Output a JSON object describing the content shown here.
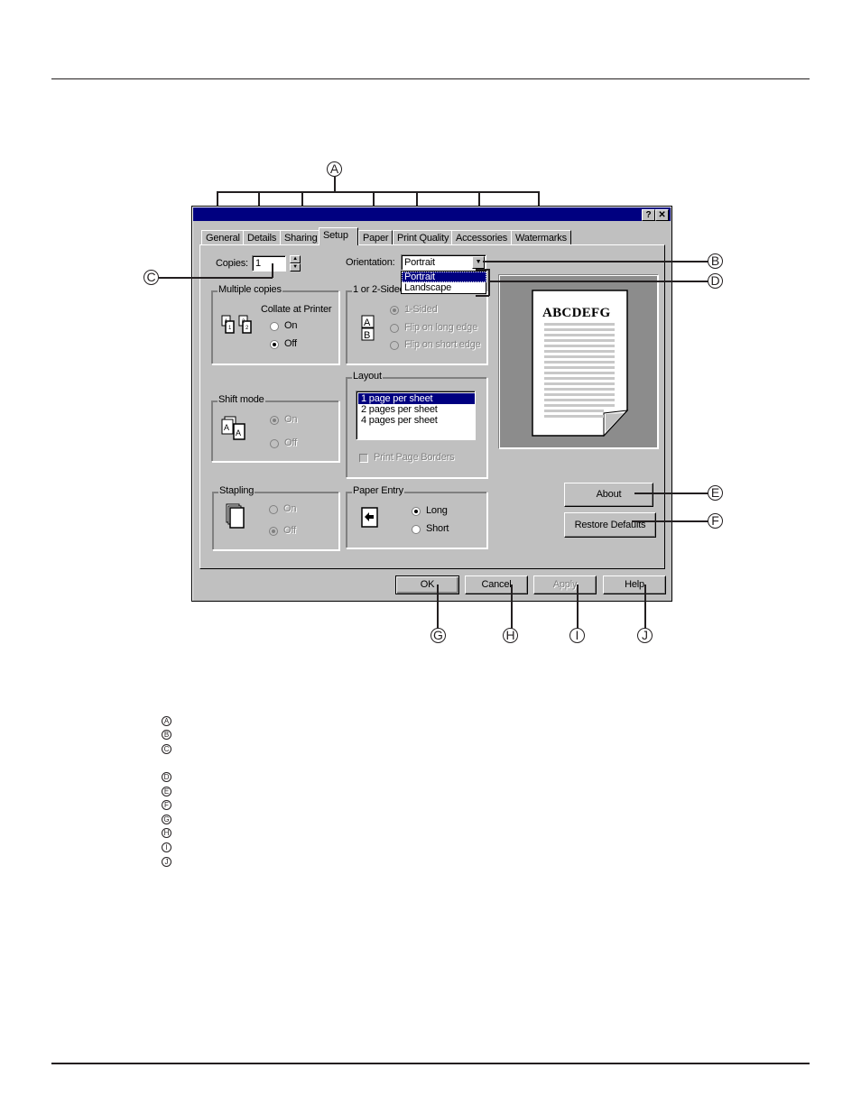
{
  "dialog": {
    "title_buttons": {
      "help": "?",
      "close": "✕"
    },
    "tabs": [
      {
        "label": "General",
        "active": false
      },
      {
        "label": "Details",
        "active": false
      },
      {
        "label": "Sharing",
        "active": false
      },
      {
        "label": "Setup",
        "active": true
      },
      {
        "label": "Paper",
        "active": false
      },
      {
        "label": "Print Quality",
        "active": false
      },
      {
        "label": "Accessories",
        "active": false
      },
      {
        "label": "Watermarks",
        "active": false
      }
    ],
    "copies": {
      "label": "Copies:",
      "value": "1"
    },
    "orientation": {
      "label": "Orientation:",
      "value": "Portrait",
      "options": [
        "Portrait",
        "Landscape"
      ],
      "highlighted": "Portrait"
    },
    "multiple_copies": {
      "title": "Multiple copies",
      "subtitle": "Collate at Printer",
      "options": [
        {
          "label": "On",
          "selected": false
        },
        {
          "label": "Off",
          "selected": true
        }
      ]
    },
    "sided": {
      "title": "1 or 2-Sided",
      "enabled": false,
      "options": [
        {
          "label": "1-Sided",
          "selected": true
        },
        {
          "label": "Flip on long edge",
          "selected": false
        },
        {
          "label": "Flip on short edge",
          "selected": false
        }
      ]
    },
    "layout": {
      "title": "Layout",
      "items": [
        "1 page per sheet",
        "2 pages per sheet",
        "4 pages per sheet"
      ],
      "selected": "1 page per sheet",
      "print_borders": {
        "label": "Print Page Borders",
        "checked": false,
        "enabled": false
      }
    },
    "shift_mode": {
      "title": "Shift mode",
      "enabled": false,
      "options": [
        {
          "label": "On",
          "selected": true
        },
        {
          "label": "Off",
          "selected": false
        }
      ]
    },
    "stapling": {
      "title": "Stapling",
      "enabled": false,
      "options": [
        {
          "label": "On",
          "selected": false
        },
        {
          "label": "Off",
          "selected": true
        }
      ]
    },
    "paper_entry": {
      "title": "Paper Entry",
      "options": [
        {
          "label": "Long",
          "selected": true
        },
        {
          "label": "Short",
          "selected": false
        }
      ]
    },
    "preview": {
      "sample_text": "ABCDEFG"
    },
    "buttons": {
      "about": "About",
      "restore_defaults": "Restore Defaults",
      "ok": "OK",
      "cancel": "Cancel",
      "apply": "Apply",
      "help": "Help"
    }
  },
  "callouts": [
    "A",
    "B",
    "C",
    "D",
    "E",
    "F",
    "G",
    "H",
    "I",
    "J"
  ],
  "legend": [
    "A",
    "B",
    "C",
    "D",
    "E",
    "F",
    "G",
    "H",
    "I",
    "J"
  ]
}
